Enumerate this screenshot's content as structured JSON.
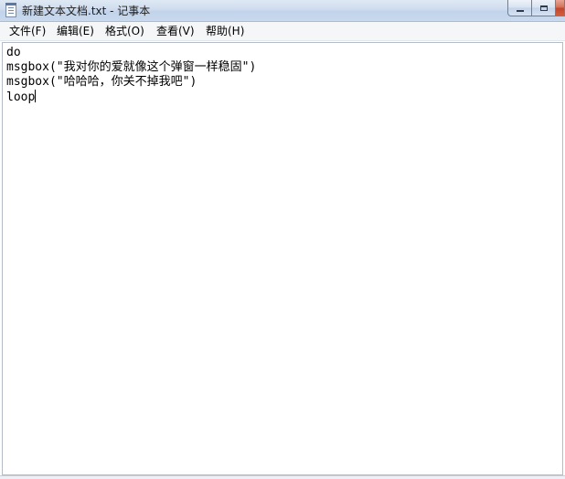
{
  "window": {
    "title": "新建文本文档.txt - 记事本"
  },
  "menu": {
    "file": "文件(F)",
    "edit": "编辑(E)",
    "format": "格式(O)",
    "view": "查看(V)",
    "help": "帮助(H)"
  },
  "editor": {
    "lines": [
      "do",
      "msgbox(\"我对你的爱就像这个弹窗一样稳固\")",
      "msgbox(\"哈哈哈，你关不掉我吧\")",
      "loop"
    ]
  },
  "colors": {
    "close_button": "#c1452a",
    "titlebar": "#c9d9ee"
  }
}
